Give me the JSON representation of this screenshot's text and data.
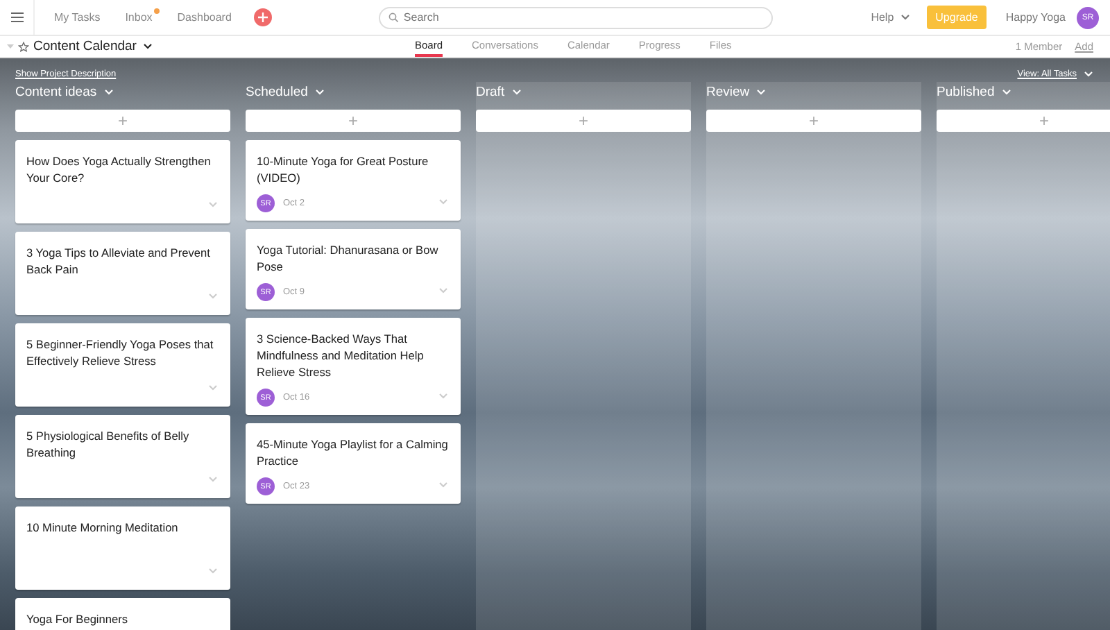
{
  "topbar": {
    "nav": [
      {
        "label": "My Tasks",
        "unread": false
      },
      {
        "label": "Inbox",
        "unread": true
      },
      {
        "label": "Dashboard",
        "unread": false
      }
    ],
    "search": {
      "placeholder": "Search"
    },
    "help": "Help",
    "upgrade": "Upgrade",
    "workspace": "Happy Yoga",
    "avatar": "SR"
  },
  "project": {
    "title": "Content Calendar",
    "tabs": [
      {
        "label": "Board",
        "selected": true
      },
      {
        "label": "Conversations",
        "selected": false
      },
      {
        "label": "Calendar",
        "selected": false
      },
      {
        "label": "Progress",
        "selected": false
      },
      {
        "label": "Files",
        "selected": false
      }
    ],
    "members": "1 Member",
    "add": "Add"
  },
  "board": {
    "description_link": "Show Project Description",
    "view": "View: All Tasks",
    "columns": [
      {
        "name": "Content ideas",
        "add": "+",
        "cards": [
          {
            "title": "How Does Yoga Actually Strengthen Your Core?"
          },
          {
            "title": "3 Yoga Tips to Alleviate and Prevent Back Pain"
          },
          {
            "title": "5 Beginner-Friendly Yoga Poses that Effectively Relieve Stress"
          },
          {
            "title": "5 Physiological Benefits of Belly Breathing"
          },
          {
            "title": "10 Minute Morning Meditation"
          },
          {
            "title": "Yoga For Beginners"
          }
        ]
      },
      {
        "name": "Scheduled",
        "add": "+",
        "cards": [
          {
            "title": "10-Minute Yoga for Great Posture (VIDEO)",
            "assignee": "SR",
            "due": "Oct 2"
          },
          {
            "title": "Yoga Tutorial: Dhanurasana or Bow Pose",
            "assignee": "SR",
            "due": "Oct 9"
          },
          {
            "title": "3 Science-Backed Ways That Mindfulness and Meditation Help Relieve Stress",
            "assignee": "SR",
            "due": "Oct 16"
          },
          {
            "title": "45-Minute Yoga Playlist for a Calming Practice",
            "assignee": "SR",
            "due": "Oct 23"
          }
        ]
      },
      {
        "name": "Draft",
        "add": "+"
      },
      {
        "name": "Review",
        "add": "+"
      },
      {
        "name": "Published",
        "add": "+"
      }
    ]
  }
}
